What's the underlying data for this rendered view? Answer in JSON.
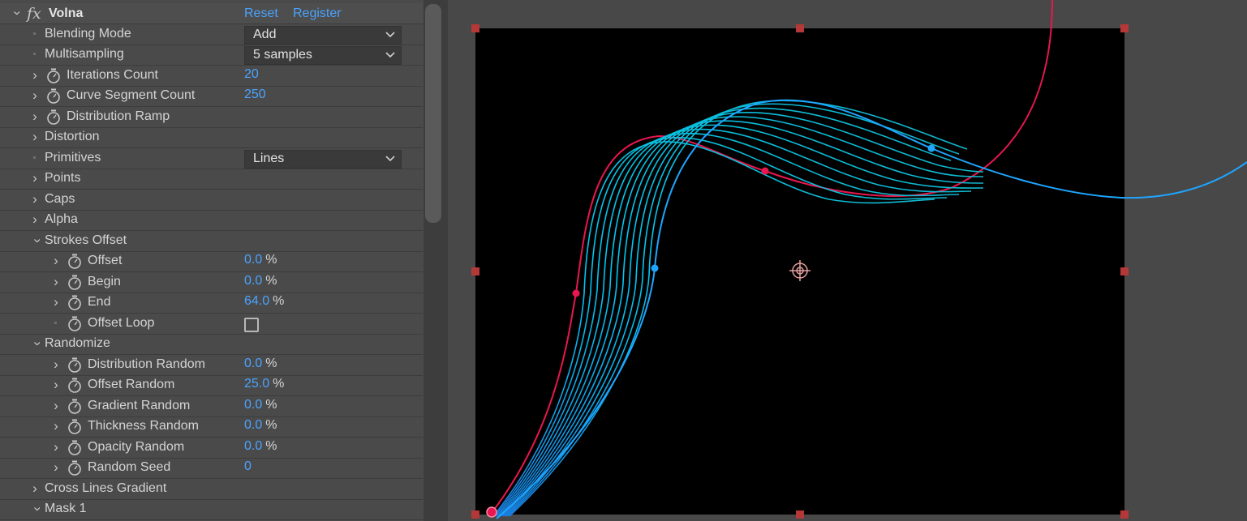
{
  "effect": {
    "name": "Volna",
    "fx_label": "fx",
    "reset_label": "Reset",
    "register_label": "Register"
  },
  "properties": {
    "blending_mode": {
      "label": "Blending Mode",
      "value": "Add"
    },
    "multisampling": {
      "label": "Multisampling",
      "value": "5 samples"
    },
    "iterations_count": {
      "label": "Iterations Count",
      "value": "20"
    },
    "curve_segment_count": {
      "label": "Curve Segment Count",
      "value": "250"
    },
    "distribution_ramp": {
      "label": "Distribution Ramp"
    },
    "distortion": {
      "label": "Distortion"
    },
    "primitives": {
      "label": "Primitives",
      "value": "Lines"
    },
    "points": {
      "label": "Points"
    },
    "caps": {
      "label": "Caps"
    },
    "alpha": {
      "label": "Alpha"
    },
    "strokes_offset": {
      "label": "Strokes Offset",
      "offset": {
        "label": "Offset",
        "value": "0.0",
        "unit": "%"
      },
      "begin": {
        "label": "Begin",
        "value": "0.0",
        "unit": "%"
      },
      "end": {
        "label": "End",
        "value": "64.0",
        "unit": "%"
      },
      "offset_loop": {
        "label": "Offset Loop",
        "checked": false
      }
    },
    "randomize": {
      "label": "Randomize",
      "distribution_random": {
        "label": "Distribution Random",
        "value": "0.0",
        "unit": "%"
      },
      "offset_random": {
        "label": "Offset Random",
        "value": "25.0",
        "unit": "%"
      },
      "gradient_random": {
        "label": "Gradient Random",
        "value": "0.0",
        "unit": "%"
      },
      "thickness_random": {
        "label": "Thickness Random",
        "value": "0.0",
        "unit": "%"
      },
      "opacity_random": {
        "label": "Opacity Random",
        "value": "0.0",
        "unit": "%"
      },
      "random_seed": {
        "label": "Random Seed",
        "value": "0"
      }
    },
    "cross_lines_gradient": {
      "label": "Cross Lines Gradient"
    },
    "mask_1": {
      "label": "Mask 1"
    }
  },
  "icons": {
    "twirl": "chevron-icon",
    "stopwatch": "stopwatch-icon",
    "dropdown": "chevron-down-icon",
    "anchor": "anchor-point-icon"
  },
  "colors": {
    "panel_bg": "#4a4a4a",
    "value_blue": "#4aa3ff",
    "path_red": "#e8174f",
    "path_blue": "#1ea6ff",
    "stroke_cyan": "#00c8e8",
    "handle_red": "#b53838"
  }
}
